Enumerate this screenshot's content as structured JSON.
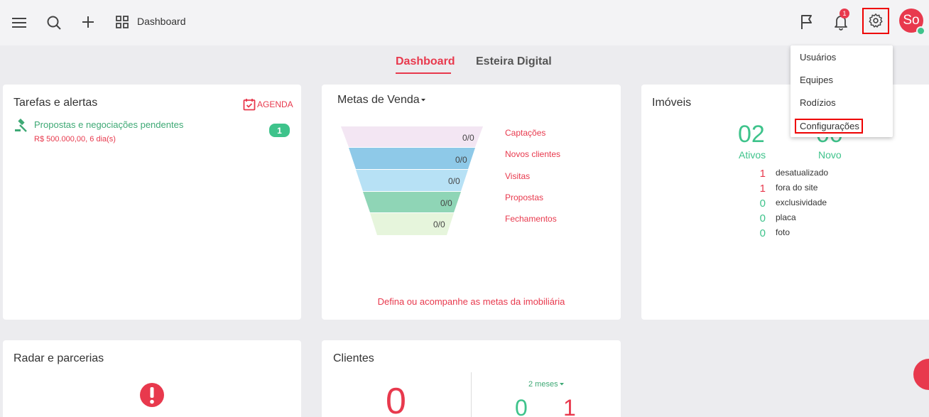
{
  "colors": {
    "accent": "#e8394d",
    "positive": "#3ec38b",
    "highlight_box": "#ee0000"
  },
  "header": {
    "breadcrumb_label": "Dashboard",
    "notification_count": "1",
    "avatar_initials": "So",
    "icons": [
      "menu-icon",
      "search-icon",
      "plus-icon",
      "grid-icon",
      "flag-icon",
      "bell-icon",
      "gear-icon"
    ]
  },
  "tabs": [
    {
      "label": "Dashboard",
      "active": true
    },
    {
      "label": "Esteira Digital",
      "active": false
    }
  ],
  "tarefas": {
    "title": "Tarefas e alertas",
    "agenda_label": "AGENDA",
    "task_link": "Propostas e negociações pendentes",
    "task_sub": "R$ 500.000,00, 6 dia(s)",
    "task_count": "1"
  },
  "metas": {
    "title": "Metas de Venda",
    "funnel": [
      {
        "value": "0/0",
        "label": "Captações",
        "color": "#f3e6f3"
      },
      {
        "value": "0/0",
        "label": "Novos clientes",
        "color": "#8ec9e8"
      },
      {
        "value": "0/0",
        "label": "Visitas",
        "color": "#b7e1f5"
      },
      {
        "value": "0/0",
        "label": "Propostas",
        "color": "#8fd5b6"
      },
      {
        "value": "0/0",
        "label": "Fechamentos",
        "color": "#e6f5dc"
      }
    ],
    "link": "Defina ou acompanhe as metas da imobiliária"
  },
  "imoveis": {
    "title": "Imóveis",
    "ativos_value": "02",
    "ativos_label": "Ativos",
    "novo_value": "00",
    "novo_label": "Novo",
    "stats": [
      {
        "n": "1",
        "label": "desatualizado"
      },
      {
        "n": "1",
        "label": "fora do site"
      },
      {
        "n": "0",
        "label": "exclusividade"
      },
      {
        "n": "0",
        "label": "placa"
      },
      {
        "n": "0",
        "label": "foto"
      }
    ]
  },
  "settings_menu": {
    "items": [
      "Usuários",
      "Equipes",
      "Rodízios",
      "Configurações"
    ]
  },
  "radar": {
    "title": "Radar e parcerias"
  },
  "clientes": {
    "title": "Clientes",
    "big_value": "0",
    "period": "2 meses",
    "value_a": "0",
    "value_b": "1"
  }
}
